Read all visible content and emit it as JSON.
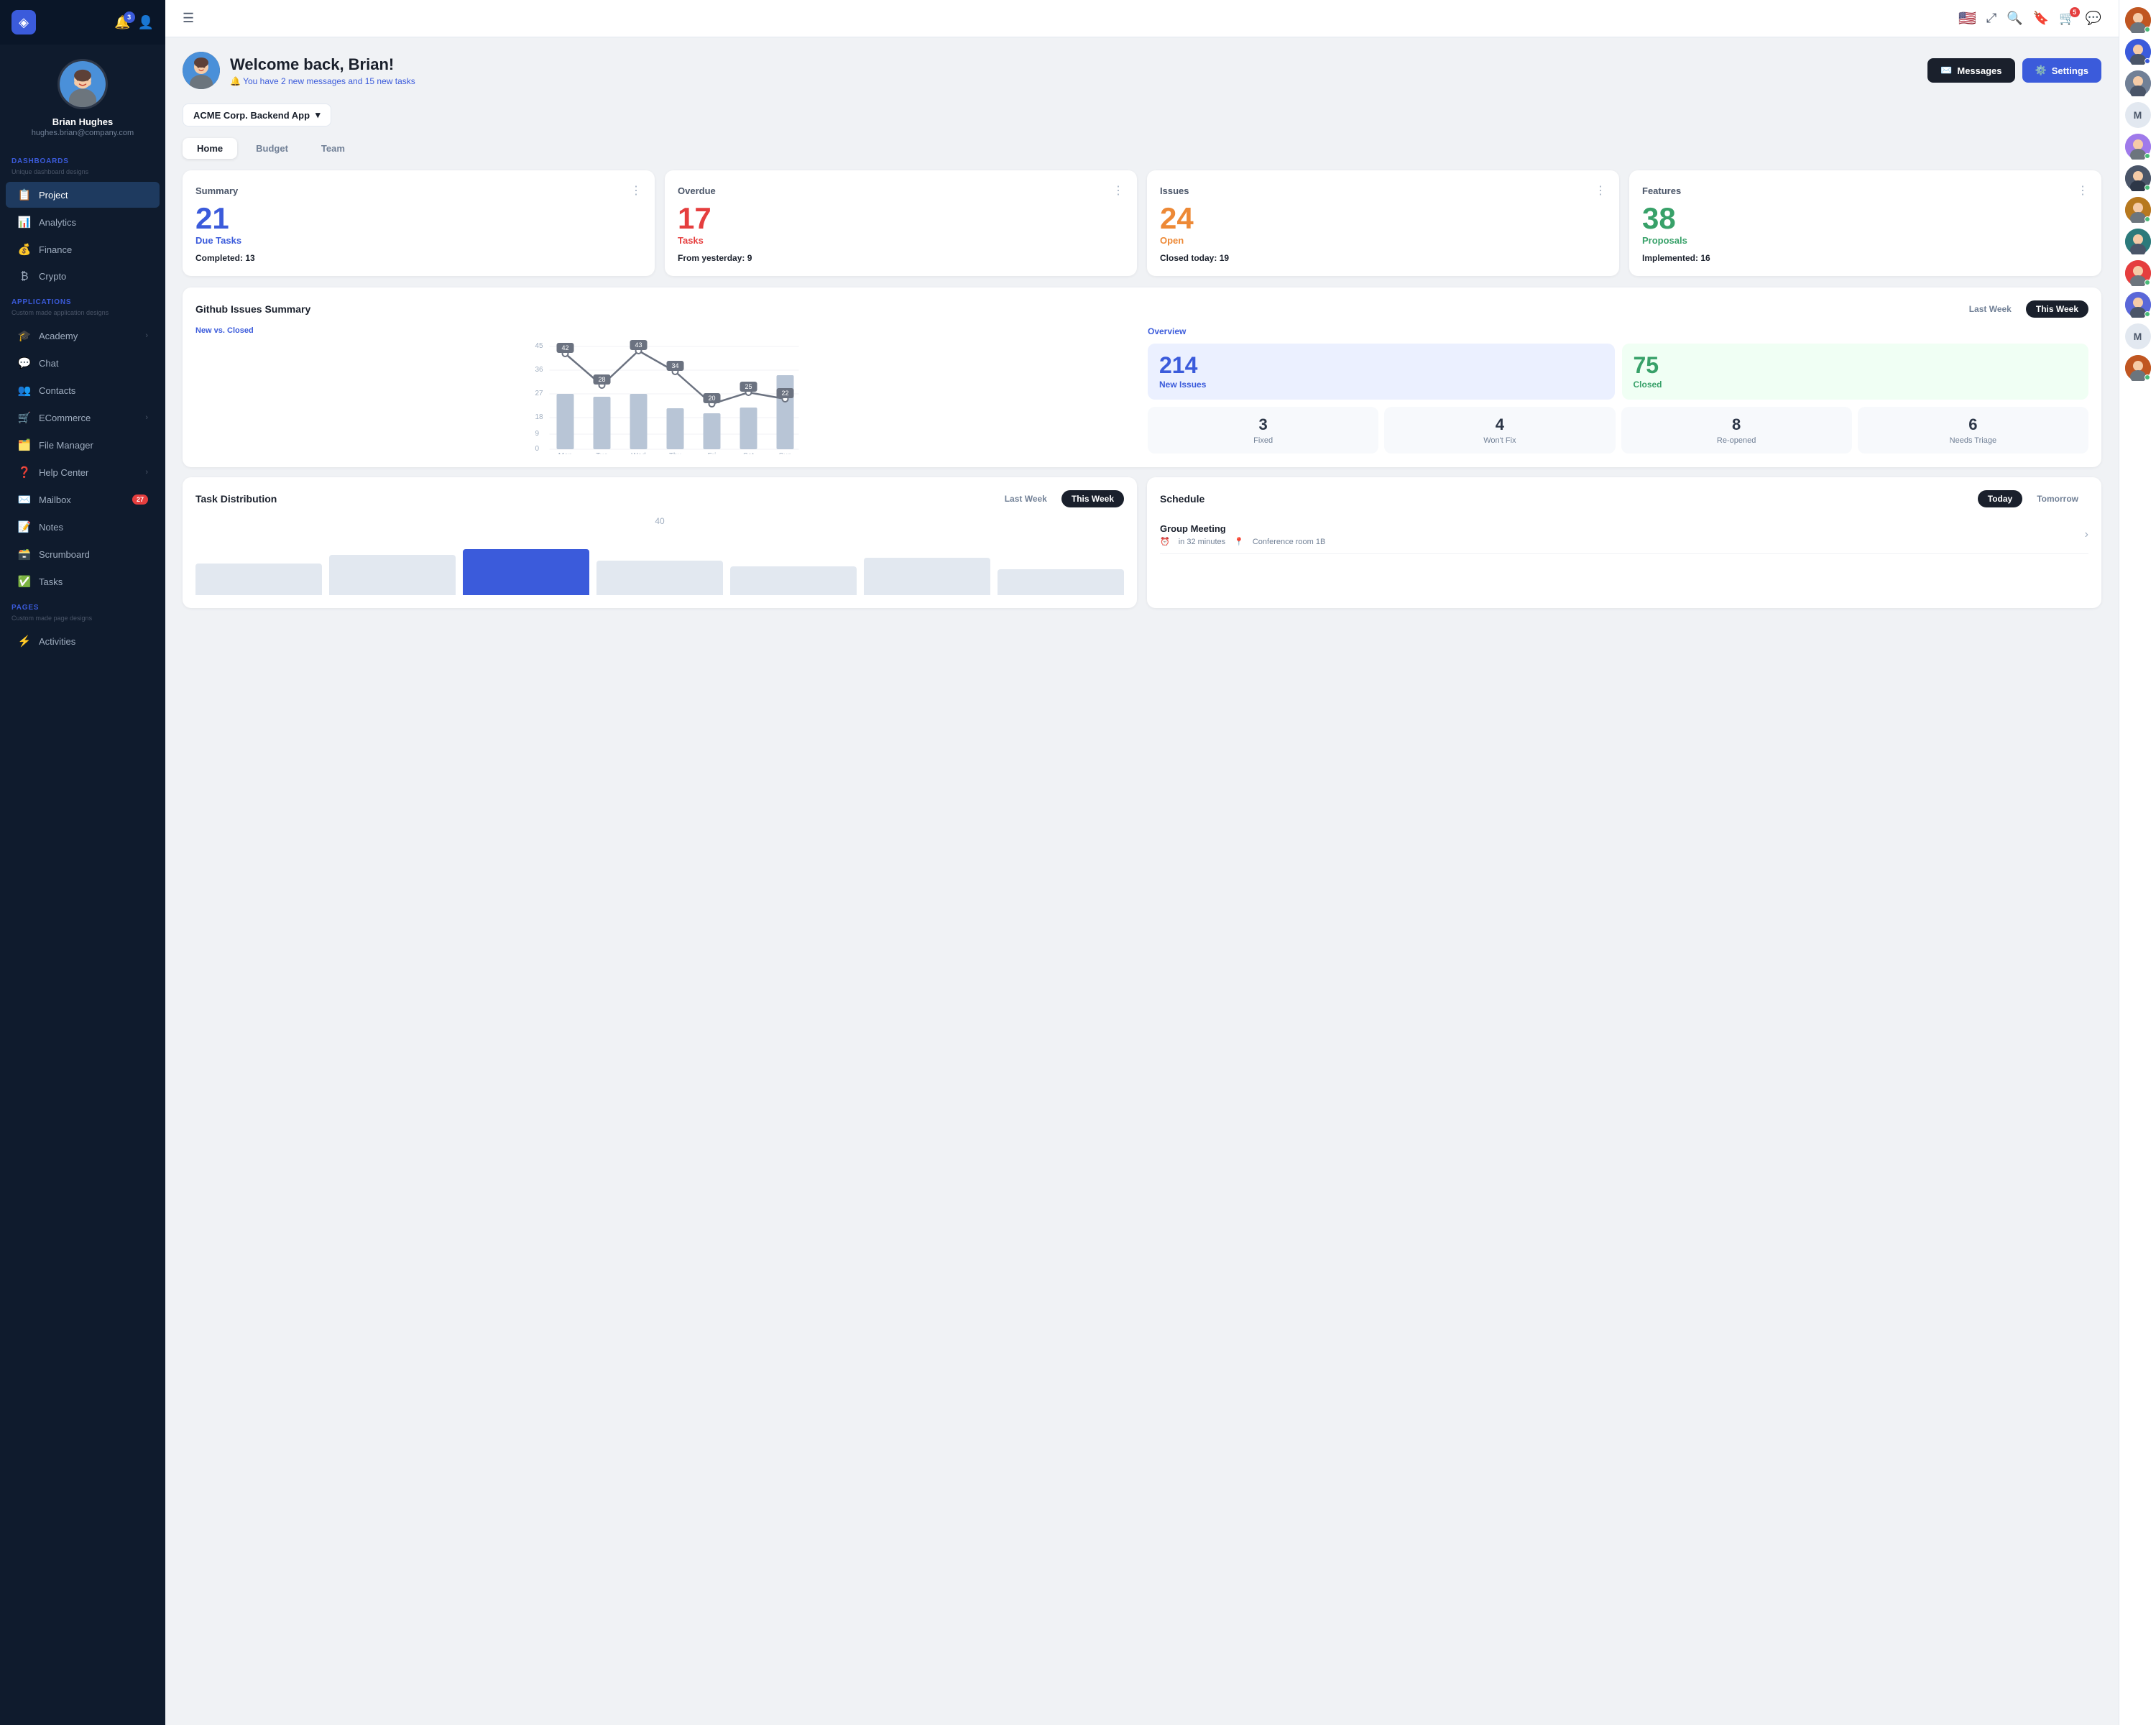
{
  "sidebar": {
    "logo": "◈",
    "notification_badge": "3",
    "user": {
      "name": "Brian Hughes",
      "email": "hughes.brian@company.com"
    },
    "dashboards_label": "DASHBOARDS",
    "dashboards_sub": "Unique dashboard designs",
    "dashboard_items": [
      {
        "icon": "📋",
        "label": "Project",
        "active": true
      },
      {
        "icon": "📊",
        "label": "Analytics"
      },
      {
        "icon": "💰",
        "label": "Finance"
      },
      {
        "icon": "₿",
        "label": "Crypto"
      }
    ],
    "applications_label": "APPLICATIONS",
    "applications_sub": "Custom made application designs",
    "app_items": [
      {
        "icon": "🎓",
        "label": "Academy",
        "arrow": true
      },
      {
        "icon": "💬",
        "label": "Chat"
      },
      {
        "icon": "👥",
        "label": "Contacts"
      },
      {
        "icon": "🛒",
        "label": "ECommerce",
        "arrow": true
      },
      {
        "icon": "🗂️",
        "label": "File Manager"
      },
      {
        "icon": "❓",
        "label": "Help Center",
        "arrow": true
      },
      {
        "icon": "✉️",
        "label": "Mailbox",
        "badge": "27"
      },
      {
        "icon": "📝",
        "label": "Notes"
      },
      {
        "icon": "🗃️",
        "label": "Scrumboard"
      },
      {
        "icon": "✅",
        "label": "Tasks"
      }
    ],
    "pages_label": "PAGES",
    "pages_sub": "Custom made page designs",
    "page_items": [
      {
        "icon": "⚡",
        "label": "Activities"
      }
    ]
  },
  "topnav": {
    "flag": "🇺🇸",
    "shopping_badge": "5"
  },
  "header": {
    "greeting": "Welcome back, Brian!",
    "subtext": "You have 2 new messages and 15 new tasks",
    "messages_btn": "Messages",
    "settings_btn": "Settings"
  },
  "project_selector": "ACME Corp. Backend App",
  "tabs": [
    "Home",
    "Budget",
    "Team"
  ],
  "active_tab": "Home",
  "stats": [
    {
      "title": "Summary",
      "number": "21",
      "number_color": "#3b5bdb",
      "label": "Due Tasks",
      "label_color": "#3b5bdb",
      "sub_text": "Completed:",
      "sub_val": "13"
    },
    {
      "title": "Overdue",
      "number": "17",
      "number_color": "#e53e3e",
      "label": "Tasks",
      "label_color": "#e53e3e",
      "sub_text": "From yesterday:",
      "sub_val": "9"
    },
    {
      "title": "Issues",
      "number": "24",
      "number_color": "#ed8936",
      "label": "Open",
      "label_color": "#ed8936",
      "sub_text": "Closed today:",
      "sub_val": "19"
    },
    {
      "title": "Features",
      "number": "38",
      "number_color": "#38a169",
      "label": "Proposals",
      "label_color": "#38a169",
      "sub_text": "Implemented:",
      "sub_val": "16"
    }
  ],
  "github_issues": {
    "title": "Github Issues Summary",
    "last_week_btn": "Last Week",
    "this_week_btn": "This Week",
    "chart_label": "New vs. Closed",
    "chart_data": {
      "days": [
        "Mon",
        "Tue",
        "Wed",
        "Thu",
        "Fri",
        "Sat",
        "Sun"
      ],
      "line_values": [
        42,
        28,
        43,
        34,
        20,
        25,
        22
      ],
      "bar_values": [
        30,
        28,
        30,
        24,
        22,
        25,
        38
      ]
    },
    "overview_label": "Overview",
    "new_issues_num": "214",
    "new_issues_label": "New Issues",
    "closed_num": "75",
    "closed_label": "Closed",
    "mini_stats": [
      {
        "num": "3",
        "label": "Fixed"
      },
      {
        "num": "4",
        "label": "Won't Fix"
      },
      {
        "num": "8",
        "label": "Re-opened"
      },
      {
        "num": "6",
        "label": "Needs Triage"
      }
    ]
  },
  "task_distribution": {
    "title": "Task Distribution",
    "last_week_btn": "Last Week",
    "this_week_btn": "This Week"
  },
  "schedule": {
    "title": "Schedule",
    "today_btn": "Today",
    "tomorrow_btn": "Tomorrow",
    "items": [
      {
        "title": "Group Meeting",
        "time": "in 32 minutes",
        "location": "Conference room 1B"
      }
    ]
  },
  "right_sidebar": {
    "avatars": [
      {
        "color": "#e53e3e",
        "dot": "green",
        "initials": "👤"
      },
      {
        "color": "#3b5bdb",
        "dot": "blue",
        "initials": "👤"
      },
      {
        "color": "#718096",
        "dot": "gray",
        "initials": "👤"
      },
      {
        "color": "#a0aec0",
        "dot": null,
        "letter": "M"
      },
      {
        "color": "#9f7aea",
        "dot": "green",
        "initials": "👤"
      },
      {
        "color": "#4a5568",
        "dot": "green",
        "initials": "👤"
      },
      {
        "color": "#c05621",
        "dot": "green",
        "initials": "👤"
      },
      {
        "color": "#2c7a7b",
        "dot": null,
        "initials": "👤"
      },
      {
        "color": "#b7791f",
        "dot": "green",
        "initials": "👤"
      },
      {
        "color": "#5a67d8",
        "dot": "green",
        "initials": "👤"
      },
      {
        "color": "#a0aec0",
        "dot": null,
        "letter": "M"
      },
      {
        "color": "#e53e3e",
        "dot": "green",
        "initials": "👤"
      }
    ]
  }
}
